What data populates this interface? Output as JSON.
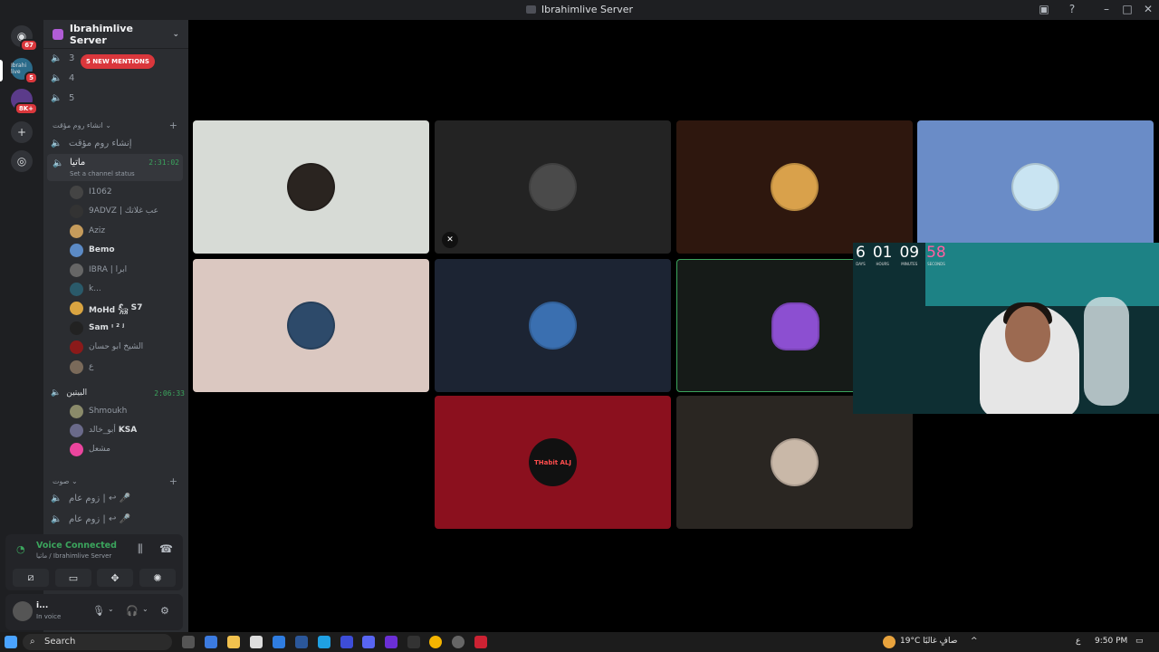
{
  "window": {
    "title": "Ibrahimlive Server"
  },
  "guilds": {
    "home_badge": "67",
    "server1_label": "Ibrahi live",
    "server1_badge": "5",
    "server2_badge": "8K+"
  },
  "server": {
    "name": "Ibrahimlive Server",
    "mentions_pill": "5 NEW MENTIONS",
    "voice_channels_top": [
      "3",
      "4",
      "5"
    ],
    "category1": "انشاء روم مؤقت",
    "create_temp_channel": "إنشاء روم مؤقت",
    "active_channel": {
      "name": "ماتيا",
      "status": "Set a channel status",
      "time": "2:31:02"
    },
    "members1": [
      {
        "name": "I1062"
      },
      {
        "name": "9ADVZ | غلاتك",
        "suffix": "عب"
      },
      {
        "name": "Aziz"
      },
      {
        "name": "Bemo"
      },
      {
        "name": "IBRA | ابرا"
      },
      {
        "name": "k..."
      },
      {
        "name": "MoHd 𓃵",
        "suffix": "S7"
      },
      {
        "name": "Sam ᵎ ² ʲ"
      },
      {
        "name": "الشيخ ابو حسان"
      },
      {
        "name": "ع"
      }
    ],
    "second_channel": {
      "name": "البيتين",
      "time": "2:06:33"
    },
    "members2": [
      {
        "name": "Shmoukh"
      },
      {
        "name": "أبو_خالد",
        "suffix": "KSA"
      },
      {
        "name": "مشعل"
      }
    ],
    "category2": "صوت",
    "voice_channels_bottom": [
      "زوم عام | ↩ 🎤",
      "زوم عام | ↩ 🎤"
    ]
  },
  "voice_panel": {
    "title": "Voice Connected",
    "subtitle": "ماتيا / Ibrahimlive Server"
  },
  "user": {
    "name": "i...",
    "status": "In voice"
  },
  "tiles_thabit_label": "THabit ALJ",
  "cam_timer": [
    {
      "value": "6",
      "label": "DAYS"
    },
    {
      "value": "01",
      "label": "HOURS"
    },
    {
      "value": "09",
      "label": "MINUTES"
    },
    {
      "value": "58",
      "label": "SECONDS"
    }
  ],
  "taskbar": {
    "search_placeholder": "Search",
    "weather": "19°C  صافٍ غالبًا",
    "lang": "ع",
    "time": "9:50 PM"
  },
  "colors": {
    "tile1": "#d7dbd6",
    "tile2": "#232323",
    "tile3": "#2e170e",
    "tile4": "#6a8cc7",
    "tile5": "#dbc8c1",
    "tile6": "#1c2433",
    "tile7": "#161b18",
    "tile9": "#8b101e",
    "tile10": "#2a2622"
  }
}
